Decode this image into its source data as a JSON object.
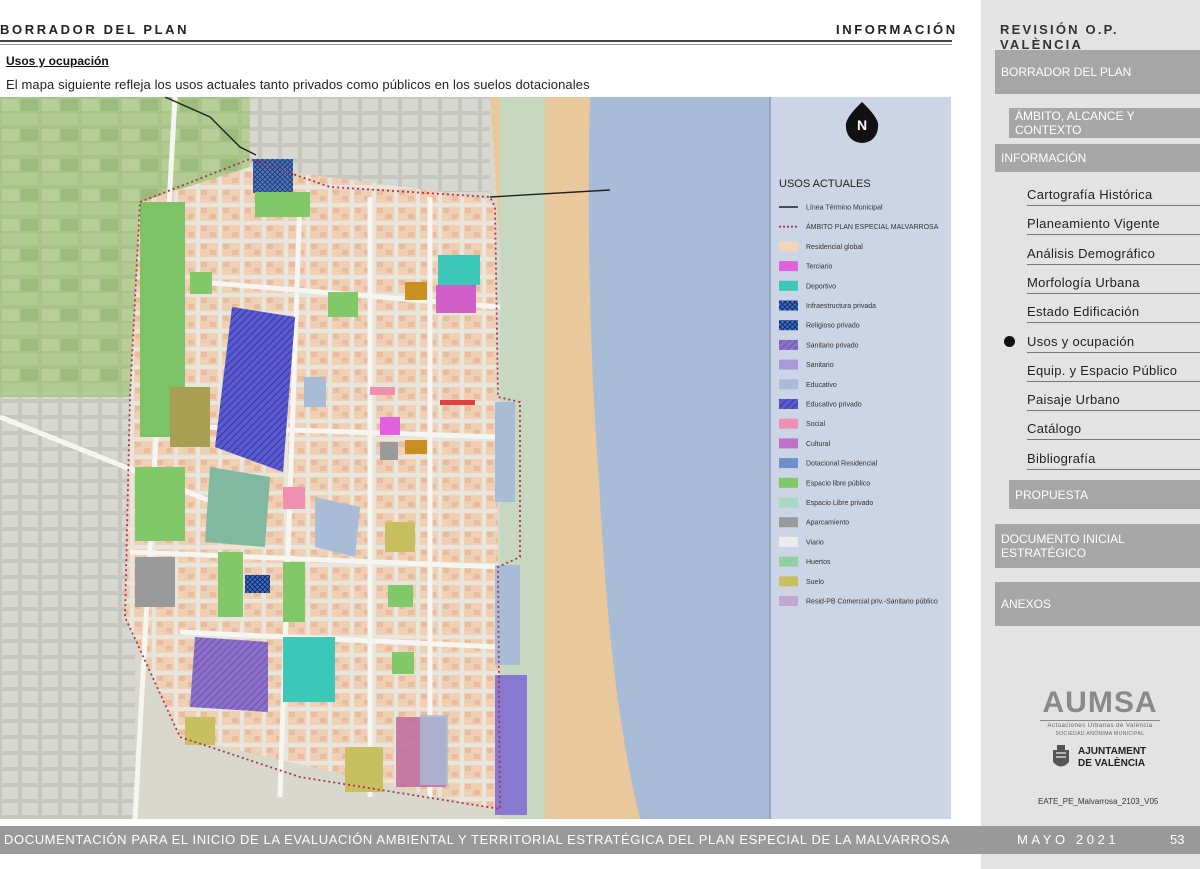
{
  "header": {
    "left_title": "BORRADOR DEL PLAN",
    "mid_title": "INFORMACIÓN",
    "right_title": "REVISIÓN O.P. VALÈNCIA"
  },
  "section": {
    "title": "Usos y ocupación",
    "text": "El mapa siguiente refleja los usos actuales tanto privados como públicos en los suelos dotacionales"
  },
  "map": {
    "north_label": "N",
    "legend_title": "USOS ACTUALES",
    "legend": [
      {
        "label": "Línea Término Municipal",
        "color": "#222222",
        "kind": "line"
      },
      {
        "label": "ÁMBITO PLAN ESPECIAL MALVARROSA",
        "color": "#b03050",
        "kind": "dotted"
      },
      {
        "label": "Residencial global",
        "color": "#f3d5bd",
        "kind": "fill"
      },
      {
        "label": "Terciario",
        "color": "#e060e0",
        "kind": "fill"
      },
      {
        "label": "Deportivo",
        "color": "#3cc8b8",
        "kind": "fill"
      },
      {
        "label": "Infraestructura privada",
        "color": "#2a58a8",
        "kind": "cross"
      },
      {
        "label": "Religioso privado",
        "color": "#5c50d8",
        "kind": "cross"
      },
      {
        "label": "Sanitario privado",
        "color": "#8478c0",
        "kind": "hatch"
      },
      {
        "label": "Sanitario",
        "color": "#a89ad8",
        "kind": "fill"
      },
      {
        "label": "Educativo",
        "color": "#a8bcd8",
        "kind": "fill"
      },
      {
        "label": "Educativo privado",
        "color": "#3040b8",
        "kind": "hatch"
      },
      {
        "label": "Social",
        "color": "#f090b0",
        "kind": "fill"
      },
      {
        "label": "Cultural",
        "color": "#c070c8",
        "kind": "fill"
      },
      {
        "label": "Dotacional Residencial",
        "color": "#6f8fc8",
        "kind": "fill"
      },
      {
        "label": "Espacio libre público",
        "color": "#80c868",
        "kind": "fill"
      },
      {
        "label": "Espacio Libre privado",
        "color": "#a8d8c0",
        "kind": "fill"
      },
      {
        "label": "Aparcamiento",
        "color": "#9a9a9a",
        "kind": "fill"
      },
      {
        "label": "Viario",
        "color": "#ebebeb",
        "kind": "fill"
      },
      {
        "label": "Huertos",
        "color": "#90d0a0",
        "kind": "fill"
      },
      {
        "label": "Suelo",
        "color": "#c8c060",
        "kind": "fill"
      },
      {
        "label": "Resid-PB Comercial priv.-Sanitario público",
        "color": "#c0a8d0",
        "kind": "fill"
      }
    ]
  },
  "sidebar": {
    "borrador": "BORRADOR DEL PLAN",
    "ambito": "ÁMBITO, ALCANCE Y CONTEXTO",
    "informacion": "INFORMACIÓN",
    "items": [
      "Cartografía Histórica",
      "Planeamiento Vigente",
      "Análisis Demográfico",
      "Morfología Urbana",
      "Estado Edificación",
      "Usos y ocupación",
      "Equip. y Espacio Público",
      "Paisaje Urbano",
      "Catálogo",
      "Bibliografía"
    ],
    "active_index": 5,
    "propuesta": "PROPUESTA",
    "documento": "DOCUMENTO INICIAL ESTRATÉGICO",
    "anexos": "ANEXOS"
  },
  "logos": {
    "aumsa": "AUMSA",
    "aumsa_sub": "Actuaciones Urbanas de València",
    "aumsa_sub2": "SOCIEDAD ANÓNIMA MUNICIPAL",
    "ajuntament_line1": "AJUNTAMENT",
    "ajuntament_line2": "DE VALÈNCIA"
  },
  "doc_code": "EATE_PE_Malvarrosa_2103_V05",
  "footer": {
    "text": "DOCUMENTACIÓN PARA EL INICIO DE  LA EVALUACIÓN AMBIENTAL Y TERRITORIAL ESTRATÉGICA DEL PLAN ESPECIAL DE  LA MALVARROSA",
    "date": "MAYO 2021",
    "page": "53"
  }
}
